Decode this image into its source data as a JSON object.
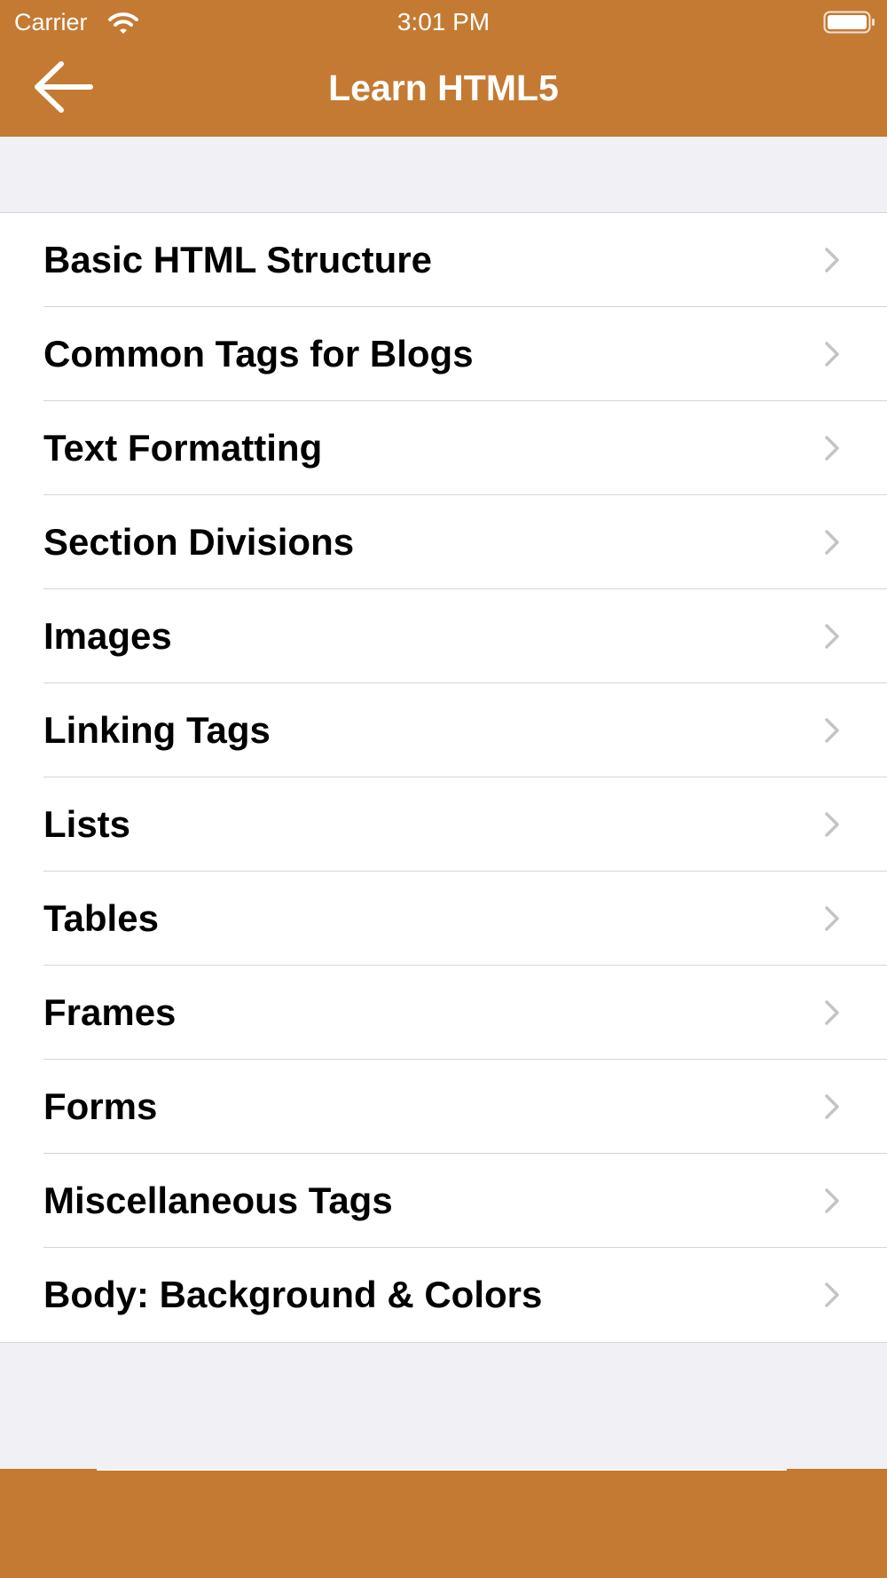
{
  "status_bar": {
    "carrier": "Carrier",
    "time": "3:01 PM"
  },
  "nav": {
    "title": "Learn HTML5",
    "back_icon": "arrow-left-icon"
  },
  "theme": {
    "accent": "#c47a32",
    "background": "#f0f0f5"
  },
  "topics": [
    {
      "label": "Basic HTML Structure"
    },
    {
      "label": "Common Tags for Blogs"
    },
    {
      "label": "Text Formatting"
    },
    {
      "label": "Section Divisions"
    },
    {
      "label": "Images"
    },
    {
      "label": "Linking Tags"
    },
    {
      "label": "Lists"
    },
    {
      "label": "Tables"
    },
    {
      "label": "Frames"
    },
    {
      "label": "Forms"
    },
    {
      "label": "Miscellaneous Tags"
    },
    {
      "label": "Body: Background & Colors"
    }
  ]
}
